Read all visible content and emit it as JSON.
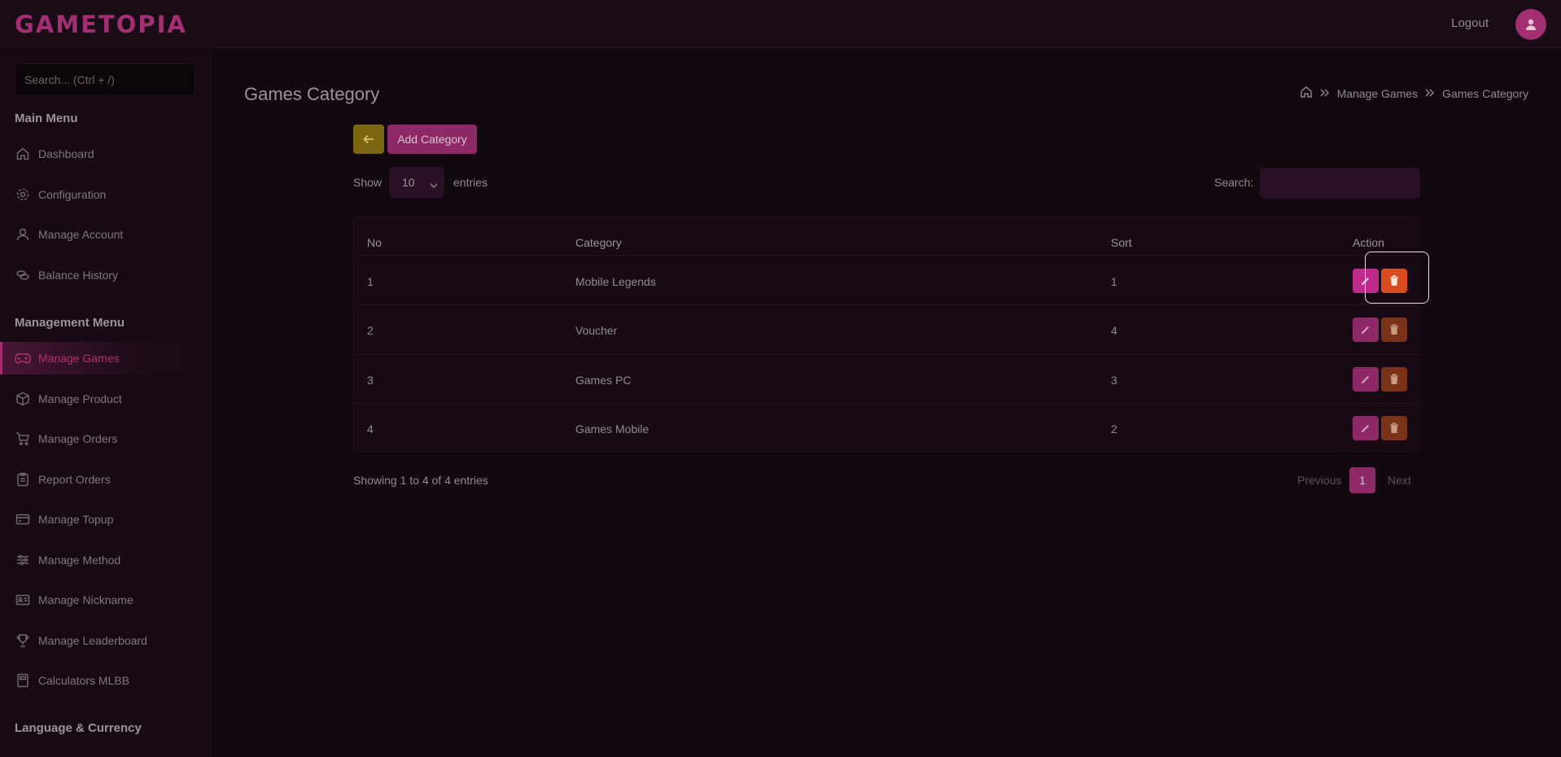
{
  "header": {
    "logo": "GAMETOPIA",
    "logout": "Logout"
  },
  "sidebar": {
    "search_placeholder": "Search... (Ctrl + /)",
    "headings": [
      "Main Menu",
      "Management Menu",
      "Language & Currency"
    ],
    "main_items": [
      {
        "label": "Dashboard",
        "icon": "home-icon"
      },
      {
        "label": "Configuration",
        "icon": "gear-icon"
      },
      {
        "label": "Manage Account",
        "icon": "user-icon"
      },
      {
        "label": "Balance History",
        "icon": "coins-icon"
      }
    ],
    "management_items": [
      {
        "label": "Manage Games",
        "icon": "gamepad-icon",
        "active": true
      },
      {
        "label": "Manage Product",
        "icon": "box-icon"
      },
      {
        "label": "Manage Orders",
        "icon": "cart-icon"
      },
      {
        "label": "Report Orders",
        "icon": "clipboard-icon"
      },
      {
        "label": "Manage Topup",
        "icon": "card-icon"
      },
      {
        "label": "Manage Method",
        "icon": "sliders-icon"
      },
      {
        "label": "Manage Nickname",
        "icon": "id-card-icon"
      },
      {
        "label": "Manage Leaderboard",
        "icon": "trophy-icon"
      },
      {
        "label": "Calculators MLBB",
        "icon": "calculator-icon"
      }
    ]
  },
  "main": {
    "title": "Games Category",
    "breadcrumb": [
      "Manage Games",
      "Games Category"
    ],
    "add_button": "Add Category",
    "show_label": "Show",
    "entries_value": "10",
    "entries_label": "entries",
    "search_label": "Search:",
    "table": {
      "headers": [
        "No",
        "Category",
        "Sort",
        "Action"
      ],
      "rows": [
        {
          "no": "1",
          "category": "Mobile Legends",
          "sort": "1"
        },
        {
          "no": "2",
          "category": "Voucher",
          "sort": "4"
        },
        {
          "no": "3",
          "category": "Games PC",
          "sort": "3"
        },
        {
          "no": "4",
          "category": "Games Mobile",
          "sort": "2"
        }
      ]
    },
    "showing": "Showing 1 to 4 of 4 entries",
    "pagination": {
      "prev": "Previous",
      "current": "1",
      "next": "Next"
    }
  },
  "colors": {
    "accent": "#a32e72",
    "background": "#12080f",
    "back_button": "#7a6510",
    "delete_button": "#7a3218"
  }
}
